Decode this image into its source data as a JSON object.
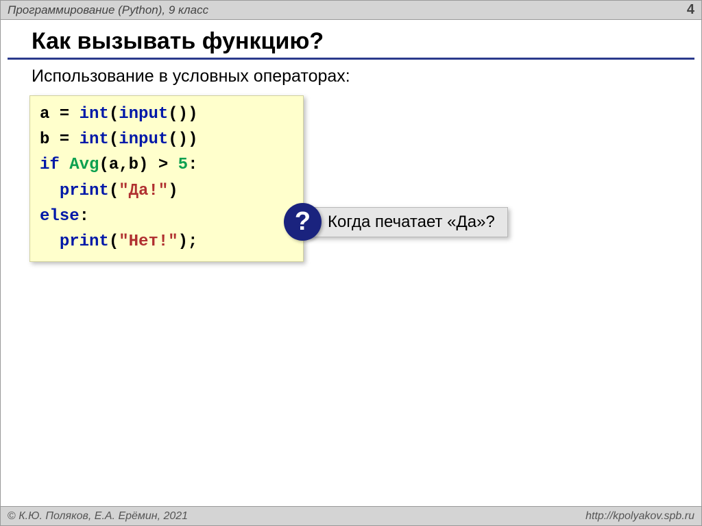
{
  "header": {
    "left": "Программирование (Python), 9 класс",
    "page_number": "4"
  },
  "title": "Как вызывать функцию?",
  "subtitle": "Использование в условных операторах:",
  "code": {
    "line1_a": "a",
    "line1_eq": " = ",
    "line1_int": "int",
    "line1_paren1": "(",
    "line1_input": "input",
    "line1_paren2": "())",
    "line2_b": "b",
    "line2_eq": " = ",
    "line2_int": "int",
    "line2_paren1": "(",
    "line2_input": "input",
    "line2_paren2": "())",
    "line3_if": "if",
    "line3_sp": " ",
    "line3_avg": "Avg",
    "line3_args": "(a,b)",
    "line3_gt": " > ",
    "line3_num": "5",
    "line3_colon": ":",
    "line4_indent": "  ",
    "line4_print": "print",
    "line4_paren1": "(",
    "line4_str": "\"Да!\"",
    "line4_paren2": ")",
    "line5_else": "else",
    "line5_colon": ":",
    "line6_indent": "  ",
    "line6_print": "print",
    "line6_paren1": "(",
    "line6_str": "\"Нет!\"",
    "line6_paren2": ");"
  },
  "callout": {
    "icon": "?",
    "text": "Когда печатает «Да»?"
  },
  "footer": {
    "left": "К.Ю. Поляков, Е.А. Ерёмин, 2021",
    "right": "http://kpolyakov.spb.ru"
  }
}
